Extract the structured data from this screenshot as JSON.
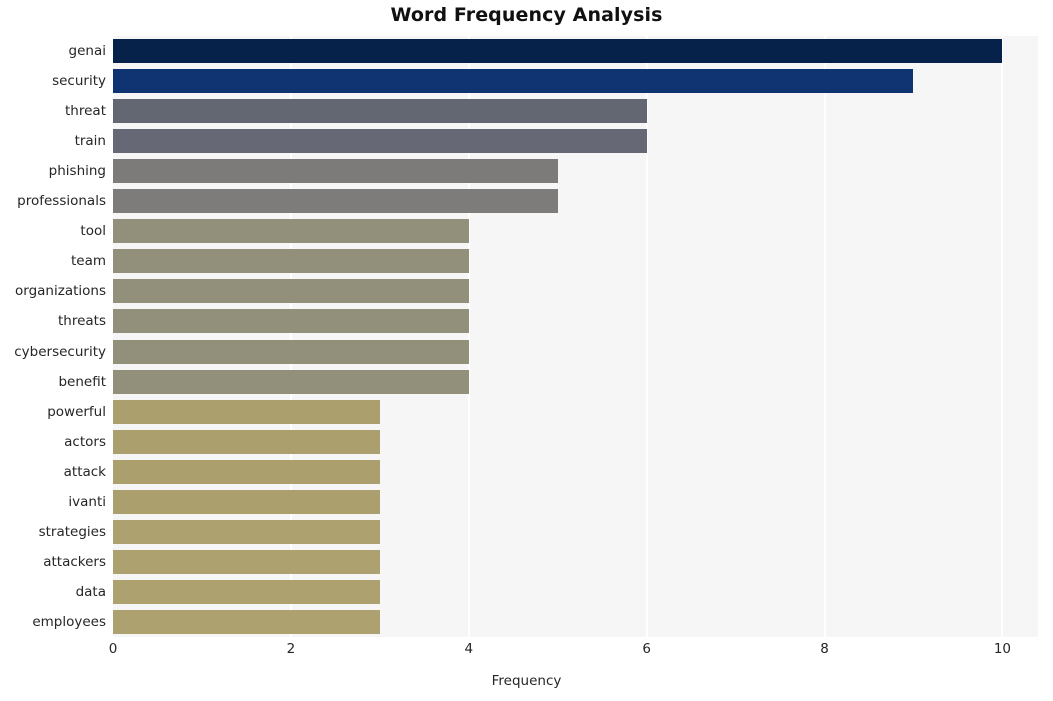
{
  "chart_data": {
    "type": "bar",
    "orientation": "horizontal",
    "title": "Word Frequency Analysis",
    "xlabel": "Frequency",
    "ylabel": "",
    "xlim": [
      0,
      10.4
    ],
    "ylim": [
      0,
      19
    ],
    "grid": true,
    "legend": null,
    "xticks": [
      0,
      2,
      4,
      6,
      8,
      10
    ],
    "xtick_labels": [
      "0",
      "2",
      "4",
      "6",
      "8",
      "10"
    ],
    "categories": [
      "genai",
      "security",
      "threat",
      "train",
      "phishing",
      "professionals",
      "tool",
      "team",
      "organizations",
      "threats",
      "cybersecurity",
      "benefit",
      "powerful",
      "actors",
      "attack",
      "ivanti",
      "strategies",
      "attackers",
      "data",
      "employees"
    ],
    "values": [
      10,
      9,
      6,
      6,
      5,
      5,
      4,
      4,
      4,
      4,
      4,
      4,
      3,
      3,
      3,
      3,
      3,
      3,
      3,
      3
    ],
    "bar_colors": [
      "#06224a",
      "#0f3471",
      "#636771",
      "#666875",
      "#7c7b7a",
      "#7d7c7a",
      "#928f7b",
      "#928f7b",
      "#928f7b",
      "#928f7b",
      "#928f7b",
      "#928f7b",
      "#ab9f6e",
      "#ac9f6e",
      "#ab9f6e",
      "#ab9f6e",
      "#ada26f",
      "#ada26f",
      "#ada26f",
      "#ada26f"
    ],
    "plot_background": "#f6f6f6",
    "gridline_color": "#ffffff",
    "figure_background": "#ffffff",
    "text_color": "#262626",
    "title_color": "#111111"
  }
}
